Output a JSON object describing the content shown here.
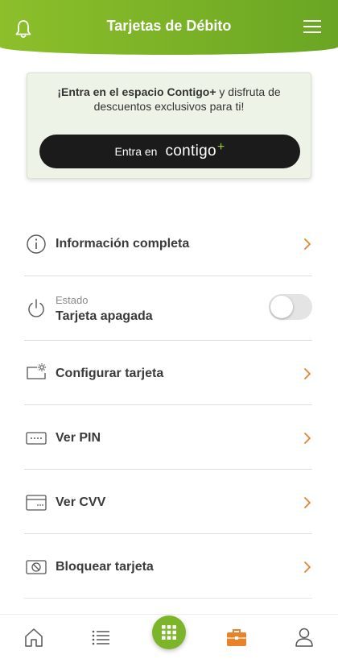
{
  "header": {
    "title": "Tarjetas de Débito",
    "bell_icon": "bell-icon",
    "menu_icon": "hamburger-menu-icon"
  },
  "promo": {
    "text_bold": "¡Entra en el espacio Contigo+",
    "text_rest": " y disfruta de descuentos exclusivos para ti!",
    "button_prefix": "Entra en",
    "logo_text": "contigo",
    "logo_plus": "+"
  },
  "list": {
    "info": {
      "label": "Información completa",
      "icon": "info-icon"
    },
    "estado": {
      "sub": "Estado",
      "label": "Tarjeta apagada",
      "icon": "power-icon",
      "toggle_on": false
    },
    "configurar": {
      "label": "Configurar tarjeta",
      "icon": "card-settings-icon"
    },
    "pin": {
      "label": "Ver PIN",
      "icon": "pin-icon"
    },
    "cvv": {
      "label": "Ver CVV",
      "icon": "card-cvv-icon"
    },
    "bloquear": {
      "label": "Bloquear tarjeta",
      "icon": "block-card-icon"
    }
  },
  "bottom_nav": {
    "items": [
      "home-icon",
      "list-icon",
      "apps-grid-icon",
      "briefcase-icon",
      "user-icon"
    ],
    "active": "briefcase-icon"
  },
  "colors": {
    "brand_green": "#7db52a",
    "accent_orange": "#e8832a",
    "button_dark": "#1b1b1b"
  }
}
